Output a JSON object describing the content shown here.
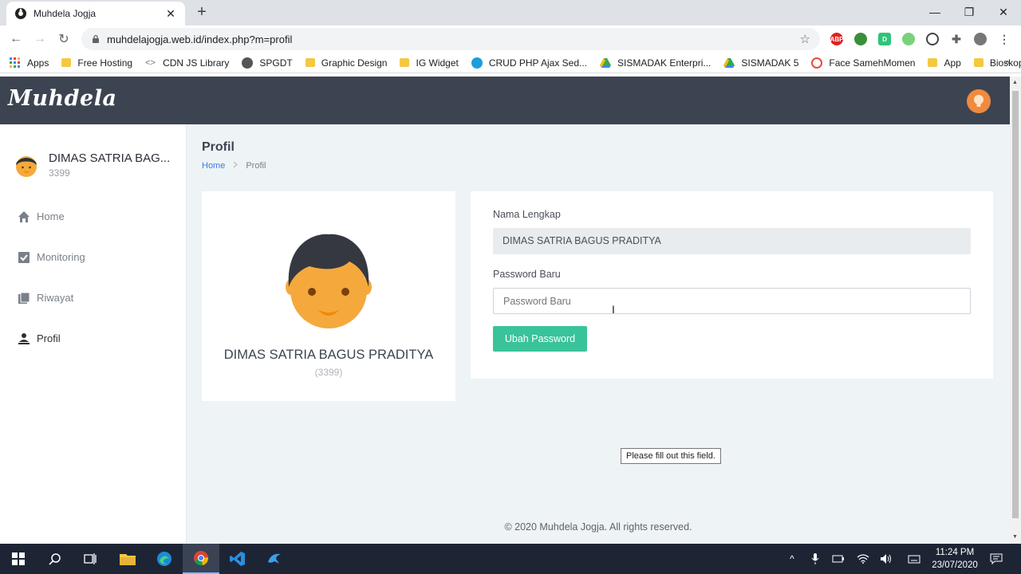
{
  "browser": {
    "tab_title": "Muhdela Jogja",
    "url": "muhdelajogja.web.id/index.php?m=profil",
    "bookmarks": [
      {
        "label": "Apps",
        "icon": "apps-grid-icon"
      },
      {
        "label": "Free Hosting",
        "icon": "folder-icon"
      },
      {
        "label": "CDN JS Library",
        "icon": "code-icon"
      },
      {
        "label": "SPGDT",
        "icon": "globe-icon"
      },
      {
        "label": "Graphic Design",
        "icon": "folder-icon"
      },
      {
        "label": "IG Widget",
        "icon": "folder-icon"
      },
      {
        "label": "CRUD PHP Ajax Sed...",
        "icon": "site-icon"
      },
      {
        "label": "SISMADAK Enterpri...",
        "icon": "drive-icon"
      },
      {
        "label": "SISMADAK 5",
        "icon": "drive-icon"
      },
      {
        "label": "Face SamehMomen",
        "icon": "site-icon"
      },
      {
        "label": "App",
        "icon": "folder-icon"
      },
      {
        "label": "Bioskop",
        "icon": "folder-icon"
      }
    ]
  },
  "app": {
    "brand": "Muhdela",
    "user_name": "DIMAS SATRIA BAG...",
    "user_id": "3399",
    "menu": [
      {
        "label": "Home",
        "icon": "home-icon"
      },
      {
        "label": "Monitoring",
        "icon": "checkbox-icon"
      },
      {
        "label": "Riwayat",
        "icon": "book-icon"
      },
      {
        "label": "Profil",
        "icon": "person-icon"
      }
    ],
    "page_title": "Profil",
    "breadcrumb": {
      "home": "Home",
      "sep": ">",
      "current": "Profil"
    },
    "profile_card": {
      "name": "DIMAS SATRIA BAGUS PRADITYA",
      "id": "(3399)"
    },
    "form": {
      "name_label": "Nama Lengkap",
      "name_value": "DIMAS SATRIA BAGUS PRADITYA",
      "password_label": "Password Baru",
      "password_placeholder": "Password Baru",
      "submit_label": "Ubah Password",
      "validation_tooltip": "Please fill out this field."
    },
    "footer": "© 2020 Muhdela Jogja. All rights reserved."
  },
  "taskbar": {
    "time": "11:24 PM",
    "date": "23/07/2020"
  },
  "colors": {
    "navbar": "#3d4451",
    "accent_button": "#39c39a",
    "link": "#3b7ddd",
    "page_bg": "#eef3f6"
  }
}
